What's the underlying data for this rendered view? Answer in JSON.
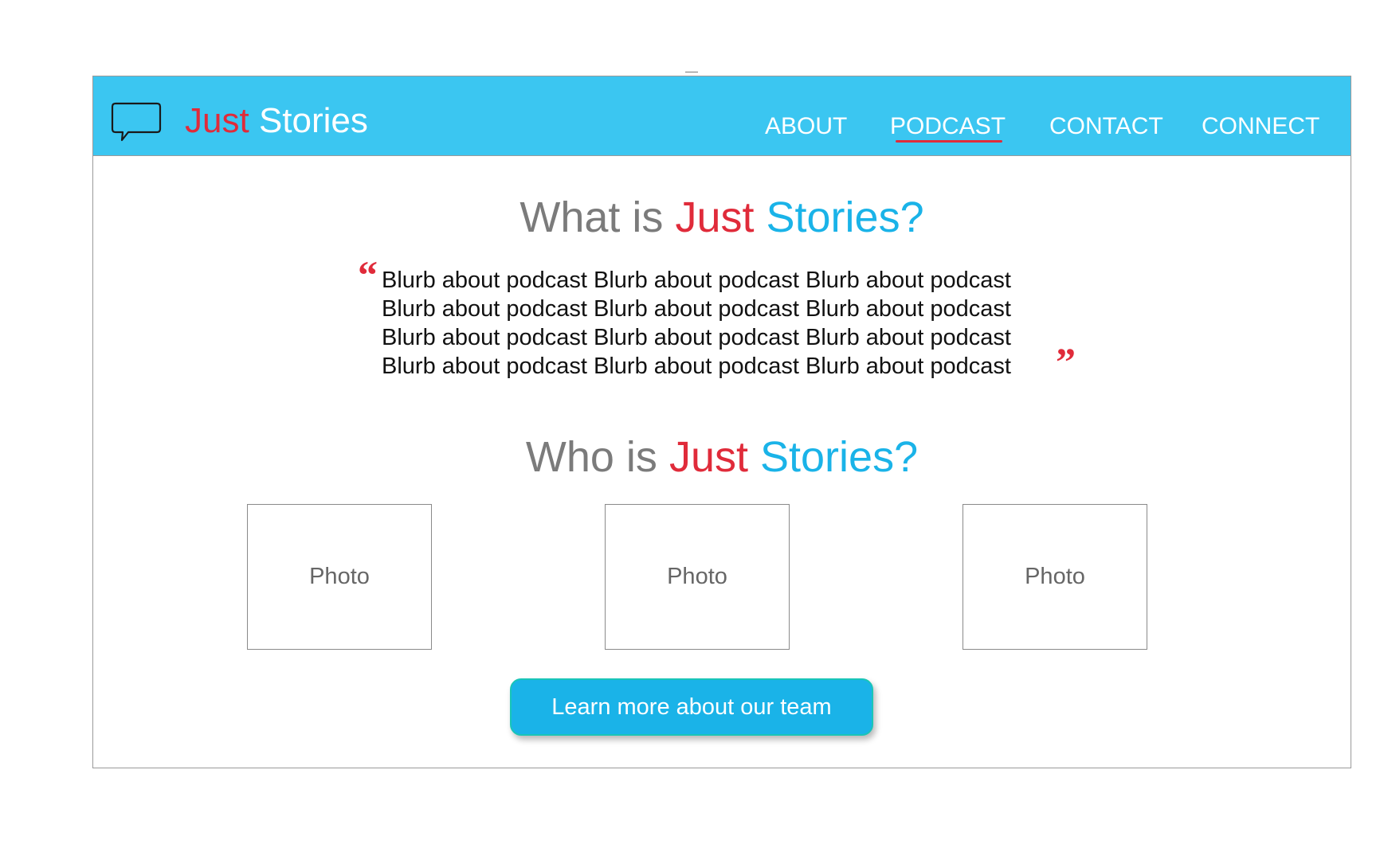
{
  "brand": {
    "logo_part1": "Just",
    "logo_part2": "Stories",
    "icon": "speech-bubble-icon",
    "accent_red": "#e02b3a",
    "accent_blue": "#1ab3e8",
    "nav_background": "#3bc6f1"
  },
  "nav": {
    "items": [
      {
        "label": "ABOUT",
        "active": false
      },
      {
        "label": "PODCAST",
        "active": true
      },
      {
        "label": "CONTACT",
        "active": false
      },
      {
        "label": "CONNECT",
        "active": false
      }
    ]
  },
  "what_section": {
    "heading_prefix": "What is ",
    "heading_part1": "Just",
    "heading_part2": "Stories?",
    "quote_open": "“",
    "quote_close": "”",
    "blurb_lines": [
      "Blurb about podcast Blurb about podcast Blurb about podcast",
      "Blurb about podcast Blurb about podcast Blurb about podcast",
      "Blurb about podcast Blurb about podcast Blurb about podcast",
      "Blurb about podcast Blurb about podcast Blurb about podcast"
    ]
  },
  "who_section": {
    "heading_prefix": "Who is ",
    "heading_part1": "Just",
    "heading_part2": "Stories?",
    "photos": [
      {
        "label": "Photo"
      },
      {
        "label": "Photo"
      },
      {
        "label": "Photo"
      }
    ],
    "cta_label": "Learn more about our team"
  }
}
